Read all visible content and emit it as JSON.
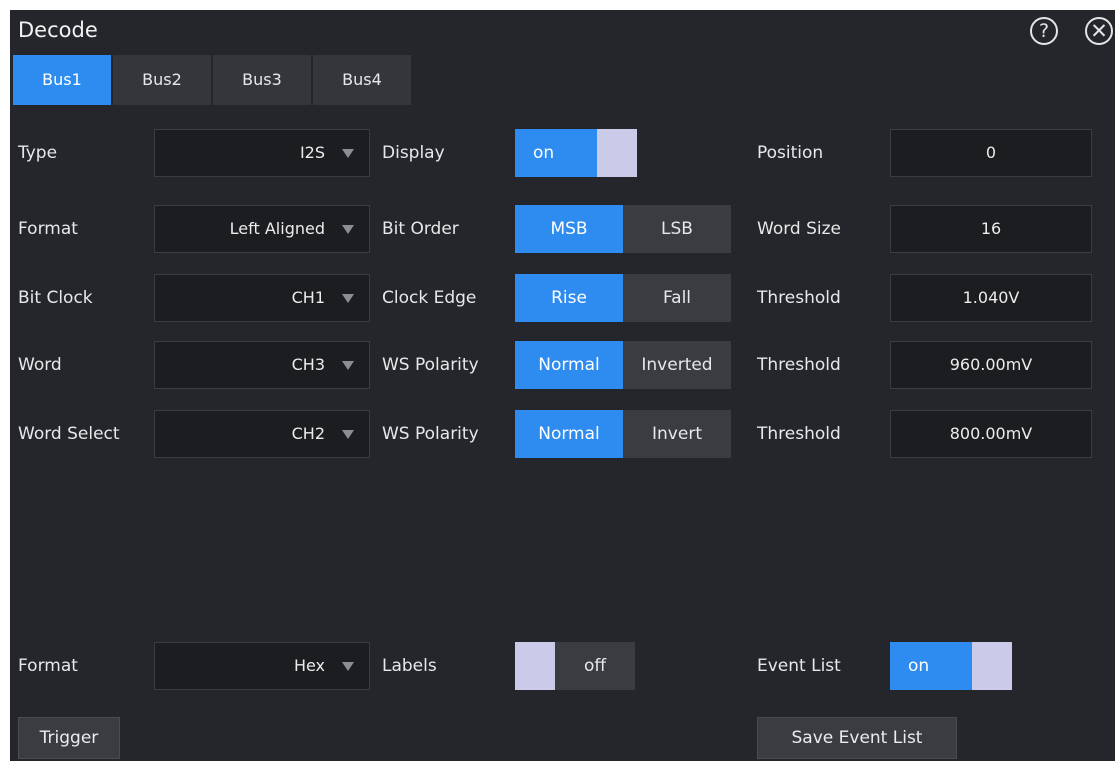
{
  "dialog": {
    "title": "Decode"
  },
  "icons": {
    "help": "help-icon",
    "close": "close-icon"
  },
  "tabs": [
    "Bus1",
    "Bus2",
    "Bus3",
    "Bus4"
  ],
  "active_tab": "Bus1",
  "left": {
    "type": {
      "label": "Type",
      "value": "I2S"
    },
    "format": {
      "label": "Format",
      "value": "Left Aligned"
    },
    "bit_clock": {
      "label": "Bit Clock",
      "value": "CH1"
    },
    "word": {
      "label": "Word",
      "value": "CH3"
    },
    "word_select": {
      "label": "Word Select",
      "value": "CH2"
    }
  },
  "middle": {
    "display": {
      "label": "Display",
      "value": "on"
    },
    "bit_order": {
      "label": "Bit Order",
      "options": [
        "MSB",
        "LSB"
      ],
      "selected": "MSB"
    },
    "clock_edge": {
      "label": "Clock Edge",
      "options": [
        "Rise",
        "Fall"
      ],
      "selected": "Rise"
    },
    "ws_polarity_1": {
      "label": "WS Polarity",
      "options": [
        "Normal",
        "Inverted"
      ],
      "selected": "Normal"
    },
    "ws_polarity_2": {
      "label": "WS Polarity",
      "options": [
        "Normal",
        "Invert"
      ],
      "selected": "Normal"
    }
  },
  "right": {
    "position": {
      "label": "Position",
      "value": "0"
    },
    "word_size": {
      "label": "Word Size",
      "value": "16"
    },
    "threshold_1": {
      "label": "Threshold",
      "value": "1.040V"
    },
    "threshold_2": {
      "label": "Threshold",
      "value": "960.00mV"
    },
    "threshold_3": {
      "label": "Threshold",
      "value": "800.00mV"
    }
  },
  "bottom": {
    "format": {
      "label": "Format",
      "value": "Hex"
    },
    "labels": {
      "label": "Labels",
      "value": "off"
    },
    "event_list": {
      "label": "Event List",
      "value": "on"
    },
    "trigger_button": "Trigger",
    "save_event_list_button": "Save Event List"
  },
  "colors": {
    "accent": "#2e8cf0",
    "panel": "#24262b",
    "toggle_knob": "#c9cbe8"
  }
}
